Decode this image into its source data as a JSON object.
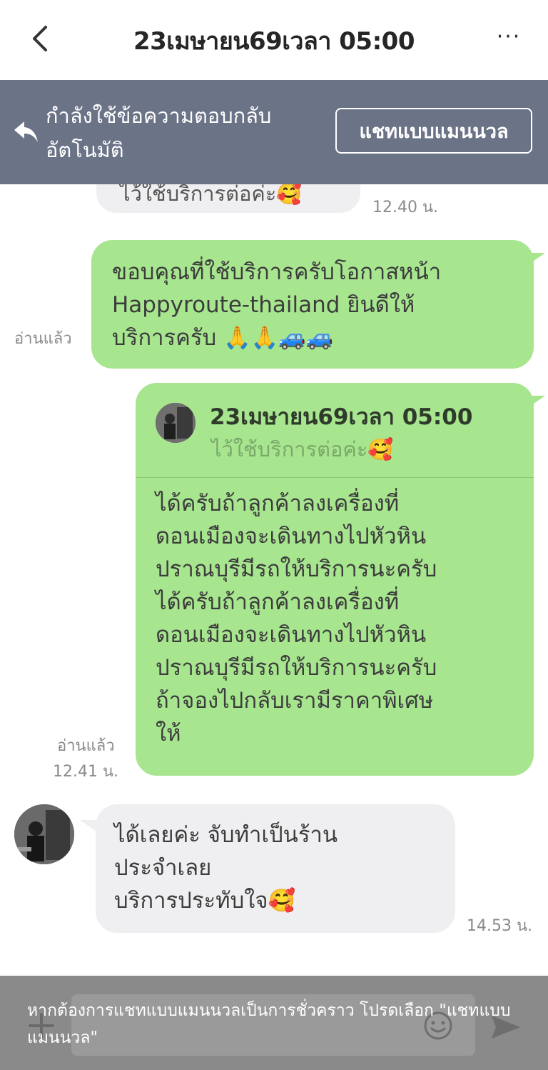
{
  "header": {
    "title": "23เมษายน69เวลา 05:00",
    "more": "···"
  },
  "banner": {
    "text_line1": "กำลังใช้ข้อความตอบกลับ",
    "text_line2": "อัตโนมัติ",
    "manual_button": "แชทแบบแมนนวล"
  },
  "chat": {
    "partial_message": "ไว้ใช้บริการต่อค่ะ🥰",
    "partial_time": "12.40 น.",
    "msg1": {
      "text": "ขอบคุณที่ใช้บริการครับโอกาสหน้า\nHappyroute-thailand ยินดีให้\nบริการครับ 🙏🙏🚙🚙",
      "read": "อ่านแล้ว"
    },
    "msg2": {
      "quote_title": "23เมษายน69เวลา 05:00",
      "quote_text": "ไว้ใช้บริการต่อค่ะ🥰",
      "text": "ได้ครับถ้าลูกค้าลงเครื่องที่\nดอนเมืองจะเดินทางไปหัวหิน\nปราณบุรีมีรถให้บริการนะครับ\nได้ครับถ้าลูกค้าลงเครื่องที่\nดอนเมืองจะเดินทางไปหัวหิน\nปราณบุรีมีรถให้บริการนะครับ\nถ้าจองไปกลับเรามีราคาพิเศษ\nให้",
      "read": "อ่านแล้ว",
      "time": "12.41 น."
    },
    "msg3": {
      "text": "ได้เลยค่ะ จับทำเป็นร้าน\nประจำเลย\nบริการประทับใจ🥰",
      "time": "14.53 น."
    }
  },
  "footer": {
    "note": "หากต้องการแชทแบบแมนนวลเป็นการชั่วคราว โปรดเลือก \"แชทแบบแมนนวล\""
  }
}
